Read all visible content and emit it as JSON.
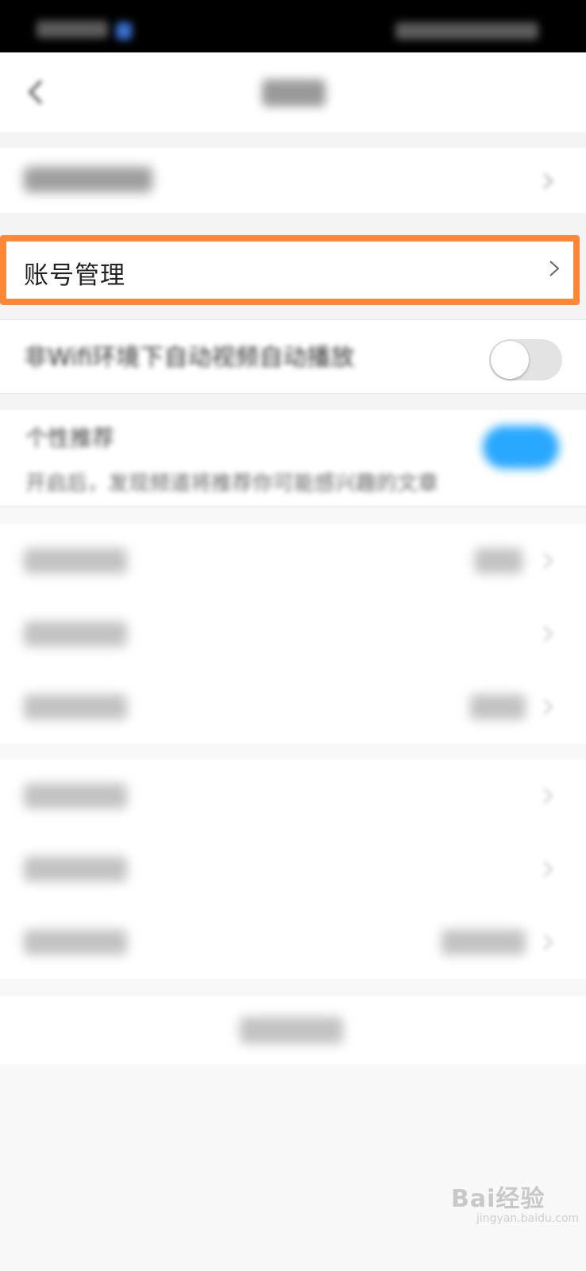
{
  "header": {
    "title": ""
  },
  "settings": {
    "account_row": {
      "label": "账号管理"
    },
    "wifi_autoplay_row": {
      "label": "非Wifi环境下自动视频自动播放",
      "toggle_on": false
    },
    "personal_row": {
      "label": "个性推荐",
      "description": "开启后，发现频道将推荐你可能感兴趣的文章",
      "toggle_on": true
    }
  },
  "watermark": {
    "text": "Bai经验",
    "sub": "jingyan.baidu.com"
  },
  "colors": {
    "highlight": "#ff8838",
    "toggle_on": "#29a8ff",
    "toggle_off": "#e3e3e3",
    "page_bg": "#f4f4f4"
  },
  "icons": [
    "back-icon",
    "chevron-right-icon",
    "toggle-switch"
  ]
}
